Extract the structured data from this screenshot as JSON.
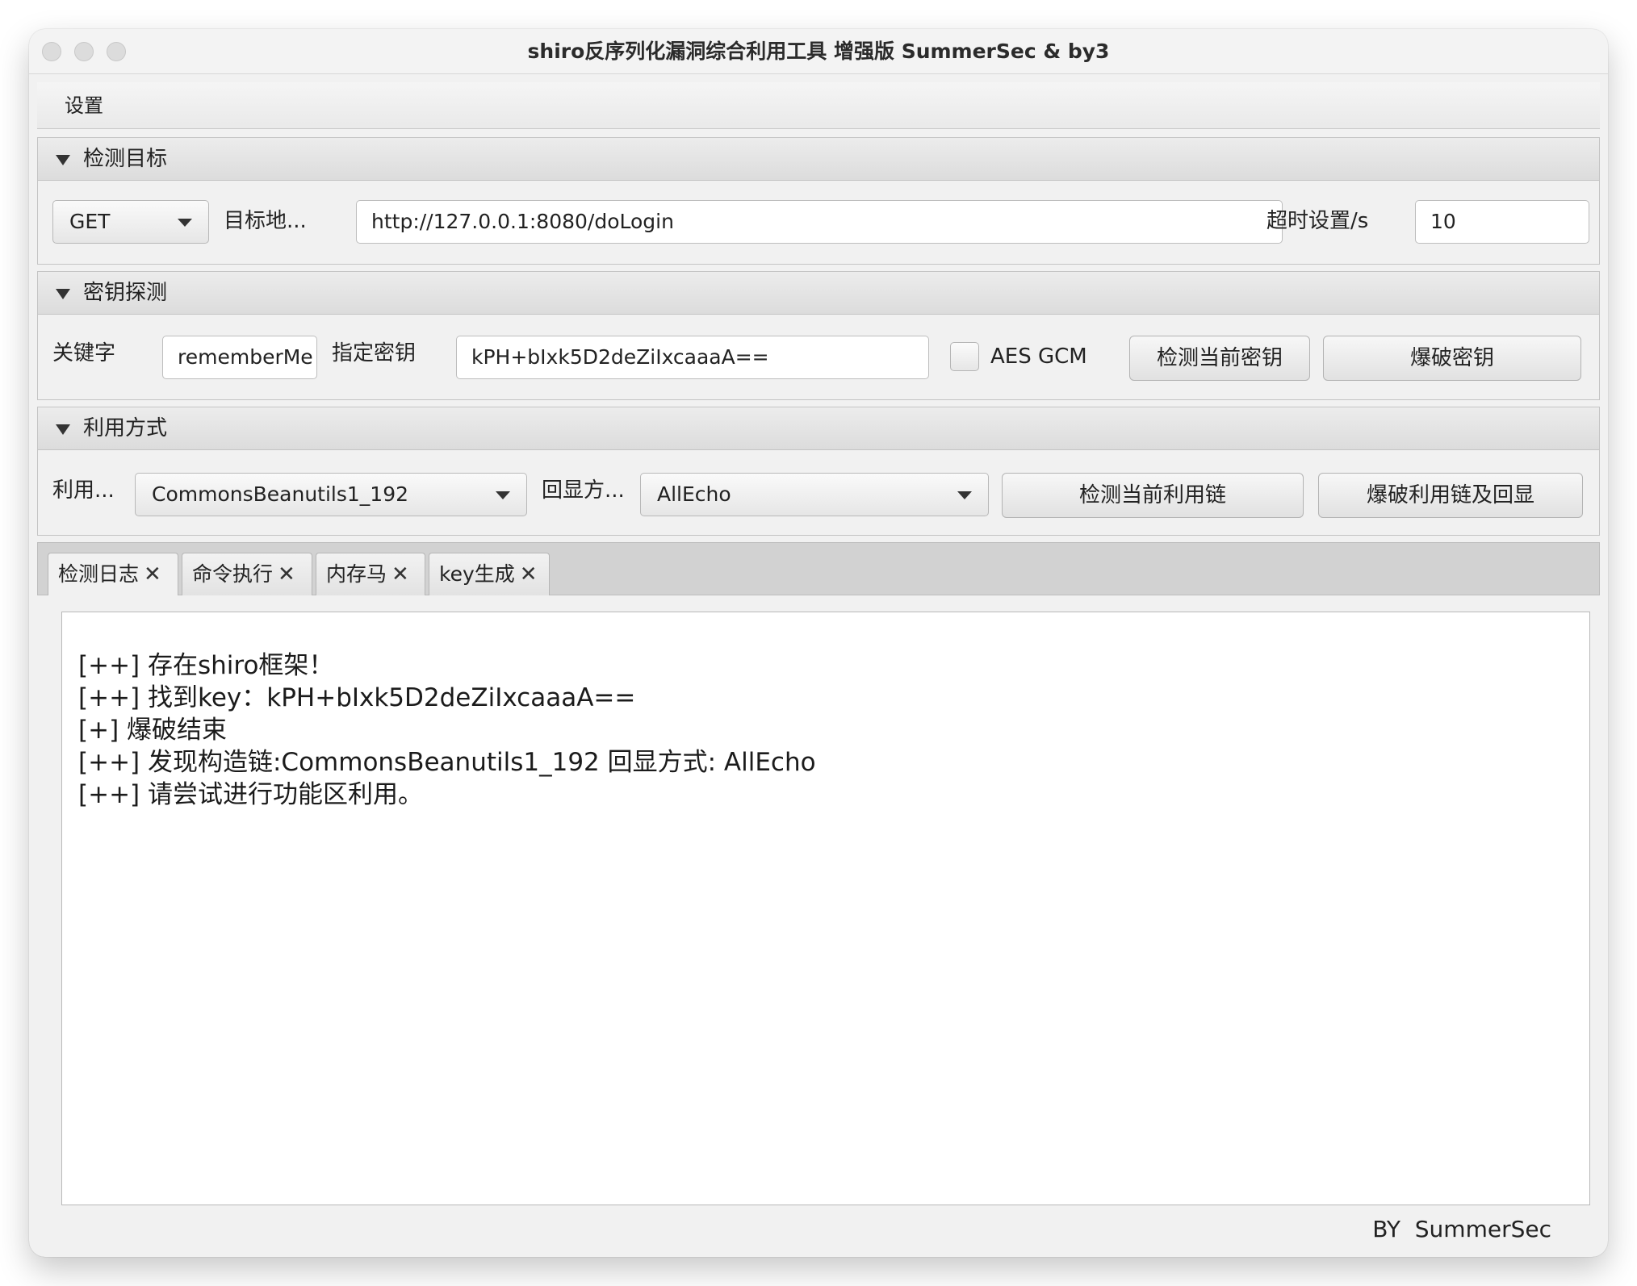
{
  "window": {
    "title": "shiro反序列化漏洞综合利用工具 增强版 SummerSec & by3"
  },
  "menubar": {
    "items": [
      "设置"
    ]
  },
  "target_section": {
    "title": "检测目标",
    "method": "GET",
    "url_label": "目标地...",
    "url_value": "http://127.0.0.1:8080/doLogin",
    "timeout_label": "超时设置/s",
    "timeout_value": "10"
  },
  "key_section": {
    "title": "密钥探测",
    "keyword_label": "关键字",
    "keyword_value": "rememberMe",
    "key_label": "指定密钥",
    "key_value": "kPH+bIxk5D2deZiIxcaaaA==",
    "aes_gcm_label": "AES GCM",
    "aes_gcm_checked": false,
    "detect_button": "检测当前密钥",
    "brute_button": "爆破密钥"
  },
  "exploit_section": {
    "title": "利用方式",
    "chain_label": "利用...",
    "chain_value": "CommonsBeanutils1_192",
    "echo_label": "回显方...",
    "echo_value": "AllEcho",
    "detect_chain_button": "检测当前利用链",
    "brute_chain_button": "爆破利用链及回显"
  },
  "tabs": [
    {
      "label": "检测日志",
      "active": true
    },
    {
      "label": "命令执行",
      "active": false
    },
    {
      "label": "内存马",
      "active": false
    },
    {
      "label": "key生成",
      "active": false
    }
  ],
  "tab_close_glyph": "✕",
  "log": [
    "[++] 存在shiro框架！",
    "[++] 找到key：kPH+bIxk5D2deZiIxcaaaA==",
    "[+] 爆破结束",
    "[++] 发现构造链:CommonsBeanutils1_192  回显方式: AllEcho",
    "[++] 请尝试进行功能区利用。"
  ],
  "footer": {
    "credit": "BY  SummerSec"
  }
}
